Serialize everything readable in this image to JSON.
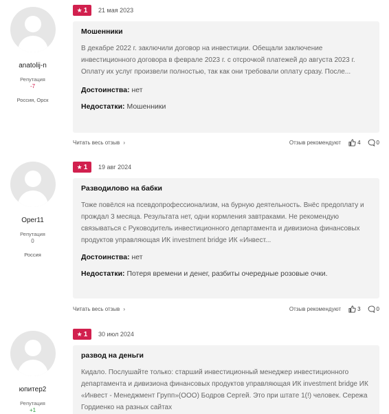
{
  "reviews": [
    {
      "author": "anatolij-n",
      "rep_label": "Репутация",
      "rep_value": "-7",
      "location": "Россия, Орск",
      "rating": "1",
      "date": "21 мая 2023",
      "title": "Мошенники",
      "text": "В декабре 2022 г. заключили договор на инвестиции. Обещали заключение инвестиционного договора в феврале 2023 г. с отсрочкой платежей до августа 2023 г. Оплату их услуг произвели полностью, так как они требовали оплату сразу. После...",
      "pros_label": "Достоинства:",
      "pros": "нет",
      "cons_label": "Недостатки:",
      "cons": "Мошенники",
      "read_more": "Читать весь отзыв",
      "recommend": "Отзыв рекомендуют",
      "likes": "4",
      "comments": "0"
    },
    {
      "author": "Oper11",
      "rep_label": "Репутация",
      "rep_value": "0",
      "location": "Россия",
      "rating": "1",
      "date": "19 авг 2024",
      "title": "Разводилово на бабки",
      "text": "Тоже повёлся на псевдопрофессионализм, на бурную деятельность. Внёс предоплату и прождал 3 месяца. Результата нет, одни кормления завтраками. Не рекомендую связываться с Руководитель инвестиционного департамента и дивизиона финансовых продуктов управляющая ИК investment bridge ИК «Инвест...",
      "pros_label": "Достоинства:",
      "pros": "нет",
      "cons_label": "Недостатки:",
      "cons": "Потеря времени и денег, разбиты очередные розовые очки.",
      "read_more": "Читать весь отзыв",
      "recommend": "Отзыв рекомендуют",
      "likes": "3",
      "comments": "0"
    },
    {
      "author": "юпитер2",
      "rep_label": "Репутация",
      "rep_value": "+1",
      "rating": "1",
      "date": "30 июл 2024",
      "title": "развод на деньги",
      "text": "Кидало. Послушайте только: старший инвестиционный менеджер инвестиционного департамента и дивизиона финансовых продуктов управляющая ИК investment bridge ИК «Инвест - Менеджмент Групп»(ООО) Бодров Сергей. Это при штате 1(!) человек. Сережа Гордиенко на разных сайтах"
    }
  ],
  "colors": {
    "badge": "#d1204e",
    "card": "#f3f3f3",
    "rep_negative": "#d1204e",
    "rep_positive": "#2a9a3a"
  },
  "icons": {
    "rating": "star-icon",
    "like": "thumb-up-icon",
    "comment": "comment-icon",
    "more": "chevron-right-icon"
  }
}
